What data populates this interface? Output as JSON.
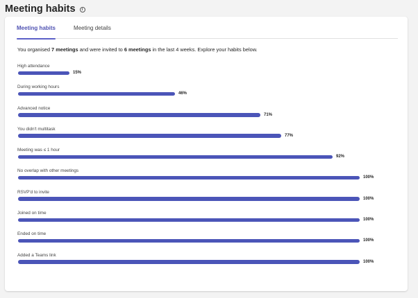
{
  "header": {
    "title": "Meeting habits"
  },
  "tabs": [
    {
      "label": "Meeting habits",
      "active": true
    },
    {
      "label": "Meeting details",
      "active": false
    }
  ],
  "summary": {
    "prefix": "You organised ",
    "organised": "7 meetings",
    "middle": " and were invited to ",
    "invited": "6 meetings",
    "suffix": " in the last 4 weeks. Explore your habits below."
  },
  "metrics": [
    {
      "label": "High attendance",
      "percent": 15,
      "text": "15%"
    },
    {
      "label": "During working hours",
      "percent": 46,
      "text": "46%"
    },
    {
      "label": "Advanced notice",
      "percent": 71,
      "text": "71%"
    },
    {
      "label": "You didn't multitask",
      "percent": 77,
      "text": "77%"
    },
    {
      "label": "Meeting was ≤ 1 hour",
      "percent": 92,
      "text": "92%"
    },
    {
      "label": "No overlap with other meetings",
      "percent": 100,
      "text": "100%"
    },
    {
      "label": "RSVP'd to invite",
      "percent": 100,
      "text": "100%"
    },
    {
      "label": "Joined on time",
      "percent": 100,
      "text": "100%"
    },
    {
      "label": "Ended on time",
      "percent": 100,
      "text": "100%"
    },
    {
      "label": "Added a Teams link",
      "percent": 100,
      "text": "100%"
    }
  ],
  "colors": {
    "accent": "#5b5fc7",
    "bar": "#4b55b8"
  }
}
